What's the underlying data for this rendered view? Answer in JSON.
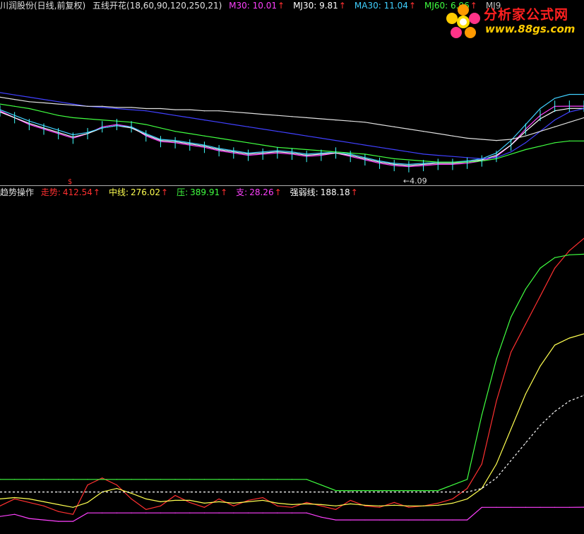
{
  "header": {
    "title": "川润股份(日线,前复权)",
    "indicator_name": "五线开花(18,60,90,120,250,21)",
    "items": [
      {
        "label": "M30:",
        "value": "10.01",
        "color": "#ff40ff"
      },
      {
        "label": "MJ30:",
        "value": "9.81",
        "color": "#ffffff"
      },
      {
        "label": "MA30:",
        "value": "11.04",
        "color": "#40d0ff"
      },
      {
        "label": "MJ60:",
        "value": "6.96",
        "color": "#40ff40"
      },
      {
        "label": "MJ9",
        "value": "",
        "color": "#c0c0c0"
      }
    ],
    "arrow": "↑"
  },
  "logo": {
    "brand": "分析家公式网",
    "url": "www.88gs.com"
  },
  "price_panel": {
    "low_marker": "←4.09",
    "signal_marker": "$"
  },
  "indicator_bar": {
    "name": "趋势操作",
    "items": [
      {
        "label": "走势:",
        "value": "412.54",
        "color": "#ff3030"
      },
      {
        "label": "中线:",
        "value": "276.02",
        "color": "#ffff50"
      },
      {
        "label": "压:",
        "value": "389.91",
        "color": "#40ff40"
      },
      {
        "label": "支:",
        "value": "28.26",
        "color": "#ff40ff"
      },
      {
        "label": "强弱线:",
        "value": "188.18",
        "color": "#ffffff"
      }
    ]
  },
  "chart_data": [
    {
      "type": "line",
      "title": "五线开花(18,60,90,120,250,21)",
      "description_series": [
        "Price bars",
        "M30",
        "MJ30",
        "MA30",
        "MJ60",
        "MJ90"
      ],
      "x": [
        0,
        1,
        2,
        3,
        4,
        5,
        6,
        7,
        8,
        9,
        10,
        11,
        12,
        13,
        14,
        15,
        16,
        17,
        18,
        19,
        20,
        21,
        22,
        23,
        24,
        25,
        26,
        27,
        28,
        29,
        30,
        31,
        32,
        33,
        34,
        35,
        36,
        37,
        38,
        39,
        40
      ],
      "series": [
        {
          "name": "M30",
          "color": "#ff40ff",
          "values": [
            9.6,
            9.0,
            8.4,
            8.0,
            7.6,
            7.2,
            7.6,
            8.2,
            8.4,
            8.2,
            7.4,
            6.9,
            6.8,
            6.6,
            6.4,
            6.1,
            5.9,
            5.7,
            5.8,
            5.9,
            5.8,
            5.6,
            5.7,
            5.9,
            5.6,
            5.3,
            5.0,
            4.8,
            4.7,
            4.8,
            4.9,
            4.9,
            5.0,
            5.2,
            5.6,
            6.6,
            8.0,
            9.2,
            10.0,
            10.01,
            10.01
          ]
        },
        {
          "name": "MJ30",
          "color": "#ffffff",
          "values": [
            9.5,
            9.0,
            8.5,
            8.1,
            7.7,
            7.3,
            7.6,
            8.1,
            8.3,
            8.1,
            7.5,
            7.0,
            6.9,
            6.7,
            6.5,
            6.2,
            6.0,
            5.8,
            5.9,
            6.0,
            5.9,
            5.7,
            5.8,
            5.9,
            5.7,
            5.4,
            5.1,
            4.9,
            4.8,
            4.9,
            5.0,
            5.0,
            5.1,
            5.3,
            5.7,
            6.6,
            7.8,
            8.9,
            9.6,
            9.81,
            9.81
          ]
        },
        {
          "name": "MA30",
          "color": "#40d0ff",
          "values": [
            9.7,
            9.2,
            8.7,
            8.3,
            7.9,
            7.5,
            7.7,
            8.1,
            8.3,
            8.2,
            7.6,
            7.1,
            7.0,
            6.8,
            6.6,
            6.3,
            6.1,
            5.9,
            6.0,
            6.1,
            6.0,
            5.8,
            5.9,
            6.0,
            5.8,
            5.5,
            5.2,
            5.0,
            4.9,
            5.0,
            5.1,
            5.1,
            5.2,
            5.4,
            5.9,
            7.0,
            8.4,
            9.8,
            10.7,
            11.04,
            11.04
          ]
        },
        {
          "name": "MJ60",
          "color": "#40ff40",
          "values": [
            10.2,
            10.0,
            9.8,
            9.5,
            9.2,
            9.0,
            8.9,
            8.8,
            8.7,
            8.6,
            8.4,
            8.1,
            7.8,
            7.6,
            7.4,
            7.2,
            7.0,
            6.8,
            6.6,
            6.4,
            6.3,
            6.2,
            6.1,
            6.0,
            5.9,
            5.8,
            5.6,
            5.4,
            5.3,
            5.2,
            5.1,
            5.1,
            5.1,
            5.2,
            5.4,
            5.8,
            6.2,
            6.5,
            6.8,
            6.96,
            6.96
          ]
        },
        {
          "name": "MJ90",
          "color": "#4040ff",
          "values": [
            11.2,
            11.0,
            10.8,
            10.6,
            10.4,
            10.2,
            10.0,
            9.9,
            9.8,
            9.7,
            9.6,
            9.4,
            9.2,
            9.0,
            8.8,
            8.6,
            8.4,
            8.2,
            8.0,
            7.8,
            7.6,
            7.4,
            7.2,
            7.0,
            6.8,
            6.6,
            6.4,
            6.2,
            6.0,
            5.8,
            5.7,
            5.6,
            5.5,
            5.4,
            5.5,
            6.0,
            6.8,
            7.8,
            8.8,
            9.5,
            9.8
          ]
        },
        {
          "name": "MJ120",
          "color": "#e0e0e0",
          "values": [
            10.8,
            10.6,
            10.4,
            10.3,
            10.2,
            10.1,
            10.0,
            10.0,
            9.9,
            9.9,
            9.8,
            9.8,
            9.7,
            9.7,
            9.6,
            9.6,
            9.5,
            9.4,
            9.3,
            9.2,
            9.1,
            9.0,
            8.9,
            8.8,
            8.7,
            8.6,
            8.4,
            8.2,
            8.0,
            7.8,
            7.6,
            7.4,
            7.2,
            7.1,
            7.0,
            7.1,
            7.4,
            7.8,
            8.2,
            8.6,
            9.0
          ]
        }
      ],
      "low_marker_value": 4.09,
      "ylim": [
        3.5,
        12.5
      ]
    },
    {
      "type": "line",
      "title": "趋势操作",
      "x": [
        0,
        1,
        2,
        3,
        4,
        5,
        6,
        7,
        8,
        9,
        10,
        11,
        12,
        13,
        14,
        15,
        16,
        17,
        18,
        19,
        20,
        21,
        22,
        23,
        24,
        25,
        26,
        27,
        28,
        29,
        30,
        31,
        32,
        33,
        34,
        35,
        36,
        37,
        38,
        39,
        40
      ],
      "series": [
        {
          "name": "走势",
          "color": "#ff3030",
          "values": [
            30,
            40,
            35,
            30,
            22,
            18,
            60,
            70,
            60,
            40,
            25,
            30,
            45,
            35,
            28,
            40,
            30,
            38,
            42,
            30,
            28,
            35,
            30,
            25,
            38,
            30,
            28,
            35,
            28,
            30,
            34,
            40,
            55,
            90,
            180,
            250,
            290,
            330,
            370,
            395,
            412.54
          ]
        },
        {
          "name": "中线",
          "color": "#ffff50",
          "values": [
            40,
            42,
            40,
            36,
            32,
            28,
            35,
            50,
            55,
            48,
            40,
            36,
            38,
            38,
            34,
            36,
            34,
            36,
            38,
            34,
            32,
            33,
            32,
            30,
            33,
            31,
            30,
            31,
            30,
            30,
            31,
            34,
            40,
            55,
            90,
            140,
            190,
            230,
            260,
            270,
            276.02
          ]
        },
        {
          "name": "压",
          "color": "#40ff40",
          "values": [
            68,
            68,
            68,
            68,
            68,
            68,
            68,
            68,
            68,
            68,
            68,
            68,
            68,
            68,
            68,
            68,
            68,
            68,
            68,
            68,
            68,
            68,
            60,
            52,
            52,
            52,
            52,
            52,
            52,
            52,
            52,
            60,
            68,
            160,
            240,
            300,
            340,
            370,
            385,
            389,
            389.91
          ]
        },
        {
          "name": "支",
          "color": "#ff40ff",
          "values": [
            15,
            18,
            12,
            10,
            8,
            8,
            20,
            20,
            20,
            20,
            20,
            20,
            20,
            20,
            20,
            20,
            20,
            20,
            20,
            20,
            20,
            20,
            14,
            10,
            10,
            10,
            10,
            10,
            10,
            10,
            10,
            10,
            10,
            28,
            28,
            28,
            28,
            28,
            28,
            28,
            28.26
          ]
        },
        {
          "name": "强弱线",
          "color": "#ffffff",
          "values": [
            50,
            50,
            50,
            50,
            50,
            50,
            50,
            50,
            50,
            50,
            50,
            50,
            50,
            50,
            50,
            50,
            50,
            50,
            50,
            50,
            50,
            50,
            50,
            50,
            50,
            50,
            50,
            50,
            50,
            50,
            50,
            50,
            50,
            55,
            70,
            95,
            120,
            145,
            165,
            180,
            188.18
          ]
        }
      ],
      "ylim": [
        0,
        450
      ]
    }
  ]
}
